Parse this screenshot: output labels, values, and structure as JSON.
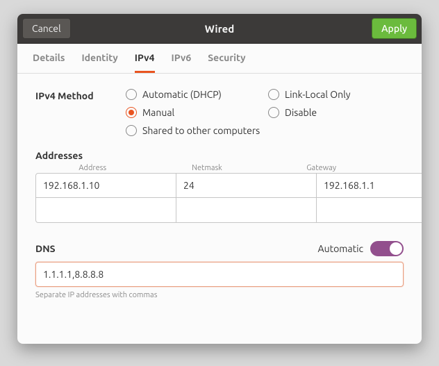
{
  "header": {
    "cancel": "Cancel",
    "title": "Wired",
    "apply": "Apply"
  },
  "tabs": {
    "details": "Details",
    "identity": "Identity",
    "ipv4": "IPv4",
    "ipv6": "IPv6",
    "security": "Security"
  },
  "method": {
    "label": "IPv4 Method",
    "auto": "Automatic (DHCP)",
    "link_local": "Link-Local Only",
    "manual": "Manual",
    "disable": "Disable",
    "shared": "Shared to other computers"
  },
  "addresses": {
    "title": "Addresses",
    "cols": {
      "address": "Address",
      "netmask": "Netmask",
      "gateway": "Gateway"
    },
    "rows": [
      {
        "address": "192.168.1.10",
        "netmask": "24",
        "gateway": "192.168.1.1"
      },
      {
        "address": "",
        "netmask": "",
        "gateway": ""
      }
    ]
  },
  "dns": {
    "title": "DNS",
    "automatic_label": "Automatic",
    "value": "1.1.1.1,8.8.8.8",
    "hint": "Separate IP addresses with commas"
  }
}
